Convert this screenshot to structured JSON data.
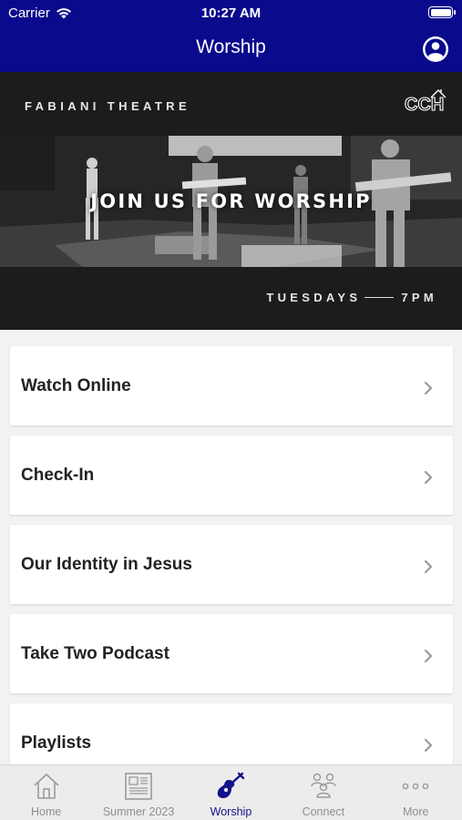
{
  "status_bar": {
    "carrier": "Carrier",
    "time": "10:27 AM"
  },
  "nav": {
    "title": "Worship",
    "profile_icon": "user-circle-icon"
  },
  "banner": {
    "venue": "FABIANI THEATRE",
    "logo_text": "CCH",
    "headline": "JOIN US FOR WORSHIP",
    "day": "TUESDAYS",
    "time": "7PM"
  },
  "list": {
    "items": [
      {
        "label": "Watch Online"
      },
      {
        "label": "Check-In"
      },
      {
        "label": "Our Identity in Jesus"
      },
      {
        "label": "Take Two Podcast"
      },
      {
        "label": "Playlists"
      }
    ]
  },
  "tabs": [
    {
      "label": "Home",
      "icon": "home-icon",
      "active": false
    },
    {
      "label": "Summer 2023",
      "icon": "newspaper-icon",
      "active": false
    },
    {
      "label": "Worship",
      "icon": "guitar-icon",
      "active": true
    },
    {
      "label": "Connect",
      "icon": "people-icon",
      "active": false
    },
    {
      "label": "More",
      "icon": "more-dots-icon",
      "active": false
    }
  ],
  "colors": {
    "brand": "#0a0a8c",
    "active_tab": "#12128a",
    "inactive_tab": "#8e8e8e"
  }
}
